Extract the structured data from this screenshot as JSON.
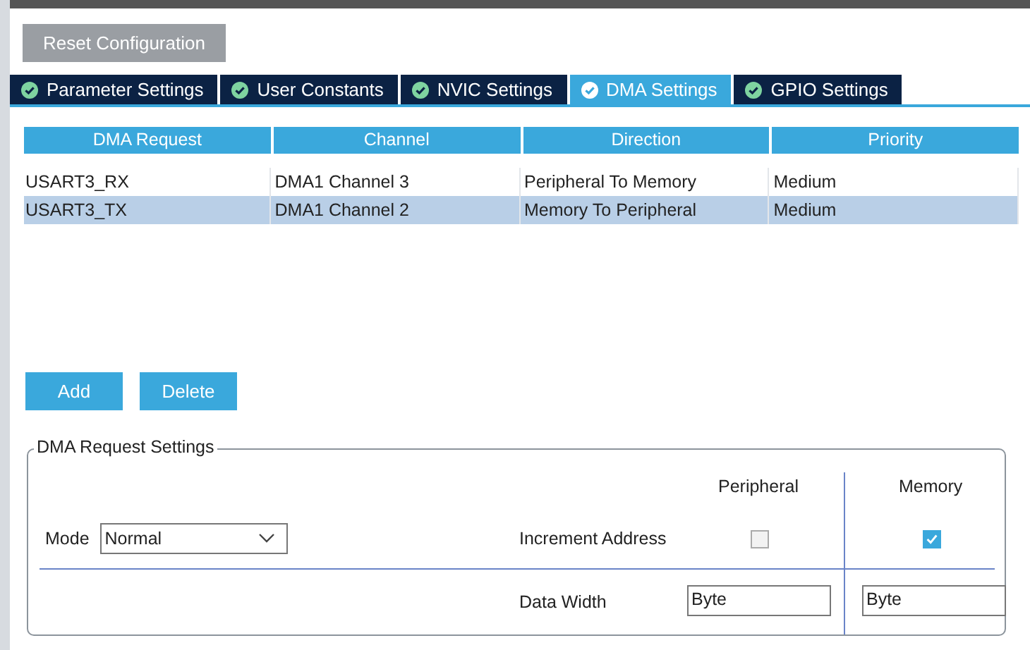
{
  "reset_button": "Reset Configuration",
  "tabs": [
    {
      "label": "Parameter Settings",
      "selected": false
    },
    {
      "label": "User Constants",
      "selected": false
    },
    {
      "label": "NVIC Settings",
      "selected": false
    },
    {
      "label": "DMA Settings",
      "selected": true
    },
    {
      "label": "GPIO Settings",
      "selected": false
    }
  ],
  "table": {
    "columns": [
      "DMA Request",
      "Channel",
      "Direction",
      "Priority"
    ],
    "rows": [
      {
        "cells": [
          "USART3_RX",
          "DMA1 Channel 3",
          "Peripheral To Memory",
          "Medium"
        ],
        "selected": false
      },
      {
        "cells": [
          "USART3_TX",
          "DMA1 Channel 2",
          "Memory To Peripheral",
          "Medium"
        ],
        "selected": true
      }
    ]
  },
  "buttons": [
    "Add",
    "Delete"
  ],
  "settings": {
    "legend": "DMA Request Settings",
    "peripheral_header": "Peripheral",
    "memory_header": "Memory",
    "mode_label": "Mode",
    "mode_value": "Normal",
    "increment_label": "Increment Address",
    "peripheral_increment": false,
    "memory_increment": true,
    "data_width_label": "Data Width",
    "peripheral_width": "Byte",
    "memory_width": "Byte"
  }
}
